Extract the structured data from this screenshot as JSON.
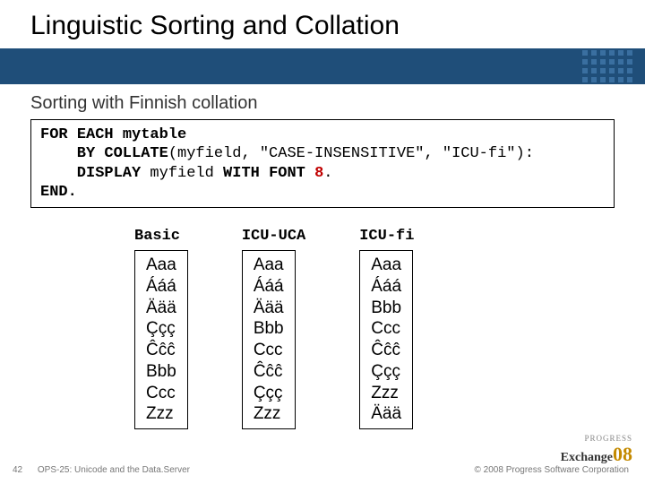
{
  "title": "Linguistic Sorting and Collation",
  "subtitle": "Sorting with Finnish collation",
  "code": {
    "l1a": "FOR",
    "l1b": "EACH",
    "l1c": "mytable",
    "l2a": "BY",
    "l2b": "COLLATE",
    "l2c": "(myfield, \"CASE-INSENSITIVE\", \"ICU-fi\"):",
    "l3a": "DISPLAY",
    "l3b": "myfield",
    "l3c": "WITH",
    "l3d": "FONT",
    "l3n": "8",
    "l3e": ".",
    "l4": "END."
  },
  "columns": [
    {
      "head": "Basic",
      "items": [
        "Aaa",
        "Ááá",
        "Äää",
        "Ççç",
        "Ĉĉĉ",
        "Bbb",
        "Ccc",
        "Zzz"
      ]
    },
    {
      "head": "ICU-UCA",
      "items": [
        "Aaa",
        "Ááá",
        "Äää",
        "Bbb",
        "Ccc",
        "Ĉĉĉ",
        "Ççç",
        "Zzz"
      ]
    },
    {
      "head": "ICU-fi",
      "items": [
        "Aaa",
        "Ááá",
        "Bbb",
        "Ccc",
        "Ĉĉĉ",
        "Ççç",
        "Zzz",
        "Äää"
      ]
    }
  ],
  "footer": {
    "page": "42",
    "left": "OPS-25: Unicode and the Data.Server",
    "right": "© 2008 Progress Software Corporation",
    "logo_brand": "PROGRESS",
    "logo_word": "Exchange",
    "logo_year": "08"
  }
}
